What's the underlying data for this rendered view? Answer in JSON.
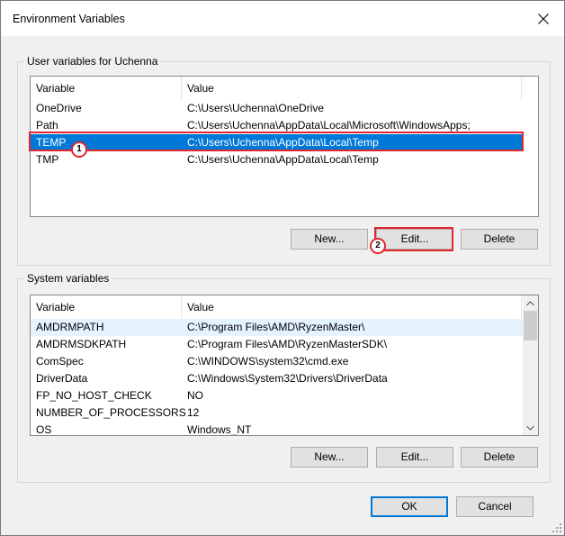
{
  "window": {
    "title": "Environment Variables"
  },
  "user_group": {
    "label": "User variables for Uchenna",
    "columns": [
      "Variable",
      "Value"
    ],
    "rows": [
      {
        "name": "OneDrive",
        "value": "C:\\Users\\Uchenna\\OneDrive"
      },
      {
        "name": "Path",
        "value": "C:\\Users\\Uchenna\\AppData\\Local\\Microsoft\\WindowsApps;"
      },
      {
        "name": "TEMP",
        "value": "C:\\Users\\Uchenna\\AppData\\Local\\Temp",
        "selected": true
      },
      {
        "name": "TMP",
        "value": "C:\\Users\\Uchenna\\AppData\\Local\\Temp"
      }
    ],
    "buttons": {
      "new": "New...",
      "edit": "Edit...",
      "delete": "Delete"
    }
  },
  "system_group": {
    "label": "System variables",
    "columns": [
      "Variable",
      "Value"
    ],
    "rows": [
      {
        "name": "AMDRMPATH",
        "value": "C:\\Program Files\\AMD\\RyzenMaster\\"
      },
      {
        "name": "AMDRMSDKPATH",
        "value": "C:\\Program Files\\AMD\\RyzenMasterSDK\\"
      },
      {
        "name": "ComSpec",
        "value": "C:\\WINDOWS\\system32\\cmd.exe"
      },
      {
        "name": "DriverData",
        "value": "C:\\Windows\\System32\\Drivers\\DriverData"
      },
      {
        "name": "FP_NO_HOST_CHECK",
        "value": "NO"
      },
      {
        "name": "NUMBER_OF_PROCESSORS",
        "value": "12"
      },
      {
        "name": "OS",
        "value": "Windows_NT"
      }
    ],
    "buttons": {
      "new": "New...",
      "edit": "Edit...",
      "delete": "Delete"
    }
  },
  "footer": {
    "ok": "OK",
    "cancel": "Cancel"
  },
  "annotations": {
    "step1": "1",
    "step2": "2"
  },
  "colors": {
    "selection": "#0078d7",
    "annotation": "#e0282e"
  }
}
